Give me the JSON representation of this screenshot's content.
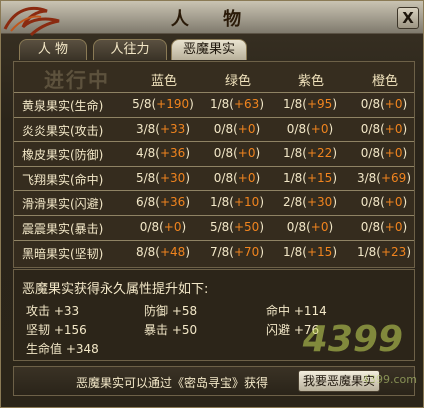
{
  "window": {
    "title": "人 物",
    "close_label": "X"
  },
  "tabs": [
    {
      "label": "人 物",
      "active": false
    },
    {
      "label": "人往力",
      "active": false
    },
    {
      "label": "恶魔果实",
      "active": true
    }
  ],
  "table": {
    "watermark": "进行中",
    "columns": [
      "蓝色",
      "绿色",
      "紫色",
      "橙色"
    ],
    "rows": [
      {
        "name": "黄泉果实(生命)",
        "cells": [
          [
            "5/8",
            "+190"
          ],
          [
            "1/8",
            "+63"
          ],
          [
            "1/8",
            "+95"
          ],
          [
            "0/8",
            "+0"
          ]
        ]
      },
      {
        "name": "炎炎果实(攻击)",
        "cells": [
          [
            "3/8",
            "+33"
          ],
          [
            "0/8",
            "+0"
          ],
          [
            "0/8",
            "+0"
          ],
          [
            "0/8",
            "+0"
          ]
        ]
      },
      {
        "name": "橡皮果实(防御)",
        "cells": [
          [
            "4/8",
            "+36"
          ],
          [
            "0/8",
            "+0"
          ],
          [
            "1/8",
            "+22"
          ],
          [
            "0/8",
            "+0"
          ]
        ]
      },
      {
        "name": "飞翔果实(命中)",
        "cells": [
          [
            "5/8",
            "+30"
          ],
          [
            "0/8",
            "+0"
          ],
          [
            "1/8",
            "+15"
          ],
          [
            "3/8",
            "+69"
          ]
        ]
      },
      {
        "name": "滑滑果实(闪避)",
        "cells": [
          [
            "6/8",
            "+36"
          ],
          [
            "1/8",
            "+10"
          ],
          [
            "2/8",
            "+30"
          ],
          [
            "0/8",
            "+0"
          ]
        ]
      },
      {
        "name": "震震果实(暴击)",
        "cells": [
          [
            "0/8",
            "+0"
          ],
          [
            "5/8",
            "+50"
          ],
          [
            "0/8",
            "+0"
          ],
          [
            "0/8",
            "+0"
          ]
        ]
      },
      {
        "name": "黑暗果实(坚韧)",
        "cells": [
          [
            "8/8",
            "+48"
          ],
          [
            "7/8",
            "+70"
          ],
          [
            "1/8",
            "+15"
          ],
          [
            "1/8",
            "+23"
          ]
        ]
      }
    ]
  },
  "bonus": {
    "title": "恶魔果实获得永久属性提升如下:",
    "stats": [
      {
        "label": "攻击 +33"
      },
      {
        "label": "防御 +58"
      },
      {
        "label": "命中 +114"
      },
      {
        "label": "坚韧 +156"
      },
      {
        "label": "暴击 +50"
      },
      {
        "label": "闪避 +76"
      },
      {
        "label": "生命值 +348"
      }
    ]
  },
  "footer": {
    "text": "恶魔果实可以通过《密岛寻宝》获得",
    "button_label": "我要恶魔果实"
  },
  "watermark_logo": {
    "big": "4399",
    "small": "4399.com"
  },
  "colors": {
    "accent_orange": "#f0841e",
    "text": "#f3e8c8"
  }
}
